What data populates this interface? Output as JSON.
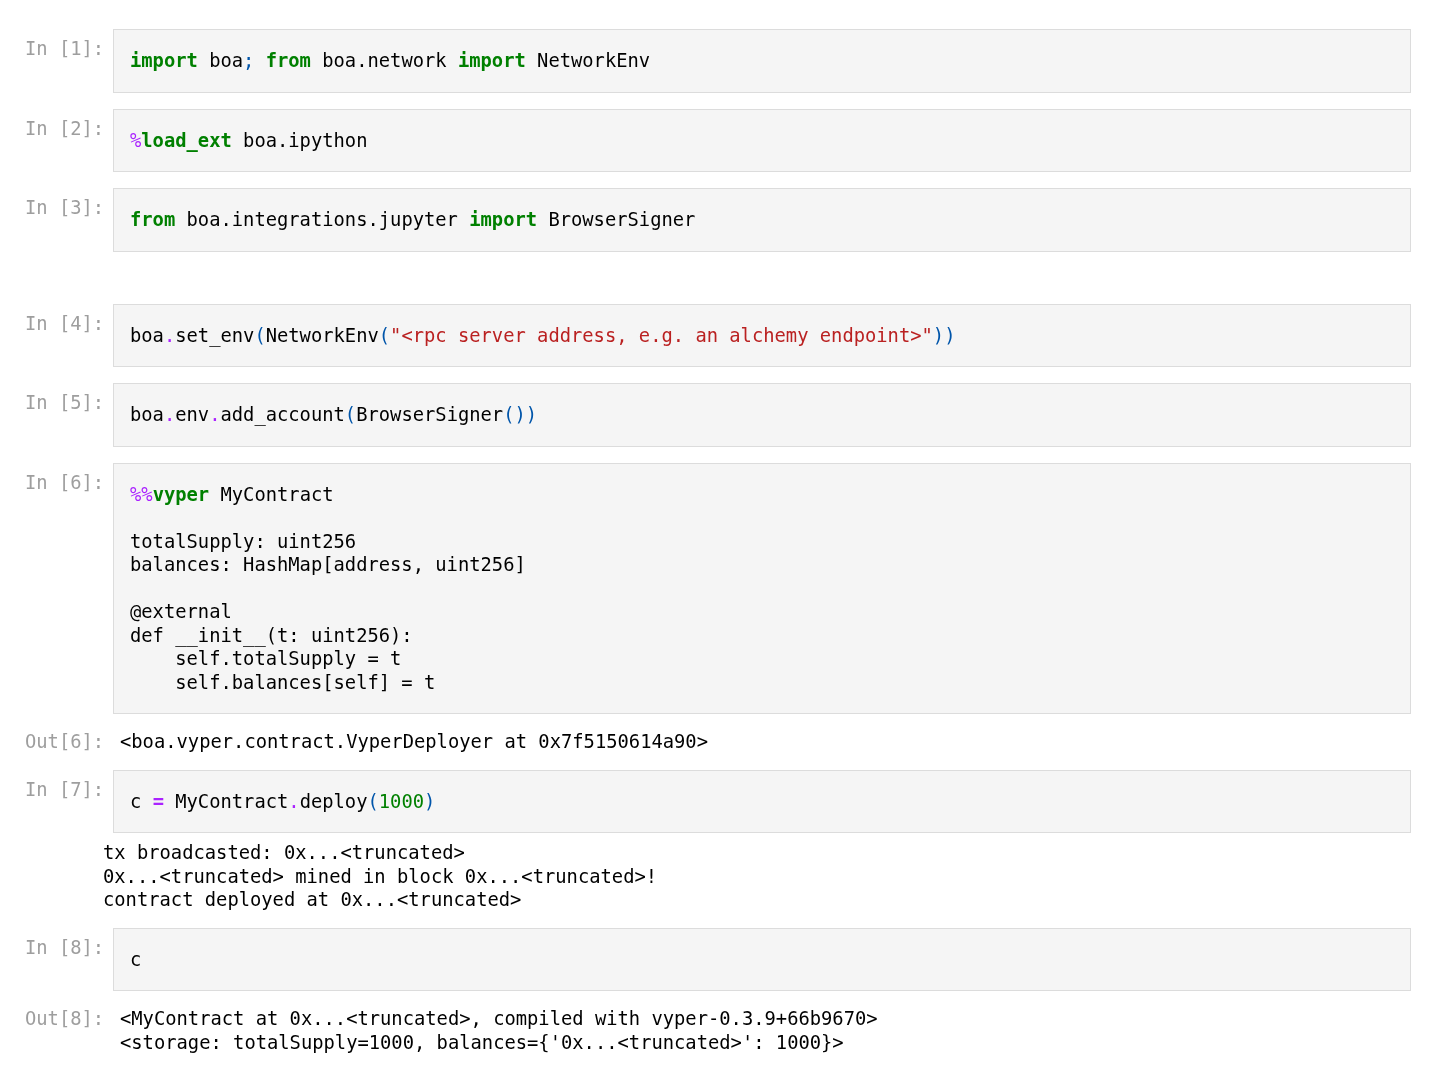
{
  "cells": [
    {
      "prompt": "In [1]:",
      "code": [
        {
          "kind": "kw",
          "t": "import"
        },
        {
          "kind": "plain",
          "t": " boa"
        },
        {
          "kind": "punc",
          "t": "; "
        },
        {
          "kind": "kw",
          "t": "from"
        },
        {
          "kind": "plain",
          "t": " boa.network "
        },
        {
          "kind": "kw",
          "t": "import"
        },
        {
          "kind": "plain",
          "t": " NetworkEnv"
        }
      ]
    },
    {
      "prompt": "In [2]:",
      "code": [
        {
          "kind": "op",
          "t": "%"
        },
        {
          "kind": "kw",
          "t": "load_ext"
        },
        {
          "kind": "plain",
          "t": " boa.ipython"
        }
      ]
    },
    {
      "prompt": "In [3]:",
      "code": [
        {
          "kind": "kw",
          "t": "from"
        },
        {
          "kind": "plain",
          "t": " boa.integrations.jupyter "
        },
        {
          "kind": "kw",
          "t": "import"
        },
        {
          "kind": "plain",
          "t": " BrowserSigner"
        }
      ]
    },
    {
      "prompt": "In [4]:",
      "spacer_before": true,
      "code": [
        {
          "kind": "plain",
          "t": "boa"
        },
        {
          "kind": "op",
          "t": "."
        },
        {
          "kind": "plain",
          "t": "set_env"
        },
        {
          "kind": "punc",
          "t": "("
        },
        {
          "kind": "plain",
          "t": "NetworkEnv"
        },
        {
          "kind": "punc",
          "t": "("
        },
        {
          "kind": "str",
          "t": "\"<rpc server address, e.g. an alchemy endpoint>\""
        },
        {
          "kind": "punc",
          "t": "))"
        }
      ]
    },
    {
      "prompt": "In [5]:",
      "code": [
        {
          "kind": "plain",
          "t": "boa"
        },
        {
          "kind": "op",
          "t": "."
        },
        {
          "kind": "plain",
          "t": "env"
        },
        {
          "kind": "op",
          "t": "."
        },
        {
          "kind": "plain",
          "t": "add_account"
        },
        {
          "kind": "punc",
          "t": "("
        },
        {
          "kind": "plain",
          "t": "BrowserSigner"
        },
        {
          "kind": "punc",
          "t": "())"
        }
      ]
    },
    {
      "prompt": "In [6]:",
      "code": [
        {
          "kind": "op",
          "t": "%%"
        },
        {
          "kind": "kw",
          "t": "vyper"
        },
        {
          "kind": "plain",
          "t": " MyContract\n\ntotalSupply: uint256\nbalances: HashMap[address, uint256]\n\n@external\ndef __init__(t: uint256):\n    self.totalSupply = t\n    self.balances[self] = t"
        }
      ],
      "outputs": [
        {
          "kind": "result",
          "prompt": "Out[6]:",
          "text": "<boa.vyper.contract.VyperDeployer at 0x7f5150614a90>"
        }
      ]
    },
    {
      "prompt": "In [7]:",
      "code": [
        {
          "kind": "plain",
          "t": "c "
        },
        {
          "kind": "opb",
          "t": "="
        },
        {
          "kind": "plain",
          "t": " MyContract"
        },
        {
          "kind": "op",
          "t": "."
        },
        {
          "kind": "plain",
          "t": "deploy"
        },
        {
          "kind": "punc",
          "t": "("
        },
        {
          "kind": "num",
          "t": "1000"
        },
        {
          "kind": "punc",
          "t": ")"
        }
      ],
      "outputs": [
        {
          "kind": "stream",
          "text": "tx broadcasted: 0x...<truncated>\n0x...<truncated> mined in block 0x...<truncated>!\ncontract deployed at 0x...<truncated>"
        }
      ]
    },
    {
      "prompt": "In [8]:",
      "code": [
        {
          "kind": "plain",
          "t": "c"
        }
      ],
      "outputs": [
        {
          "kind": "result",
          "prompt": "Out[8]:",
          "text": "<MyContract at 0x...<truncated>, compiled with vyper-0.3.9+66b9670>\n<storage: totalSupply=1000, balances={'0x...<truncated>': 1000}>"
        }
      ]
    }
  ]
}
